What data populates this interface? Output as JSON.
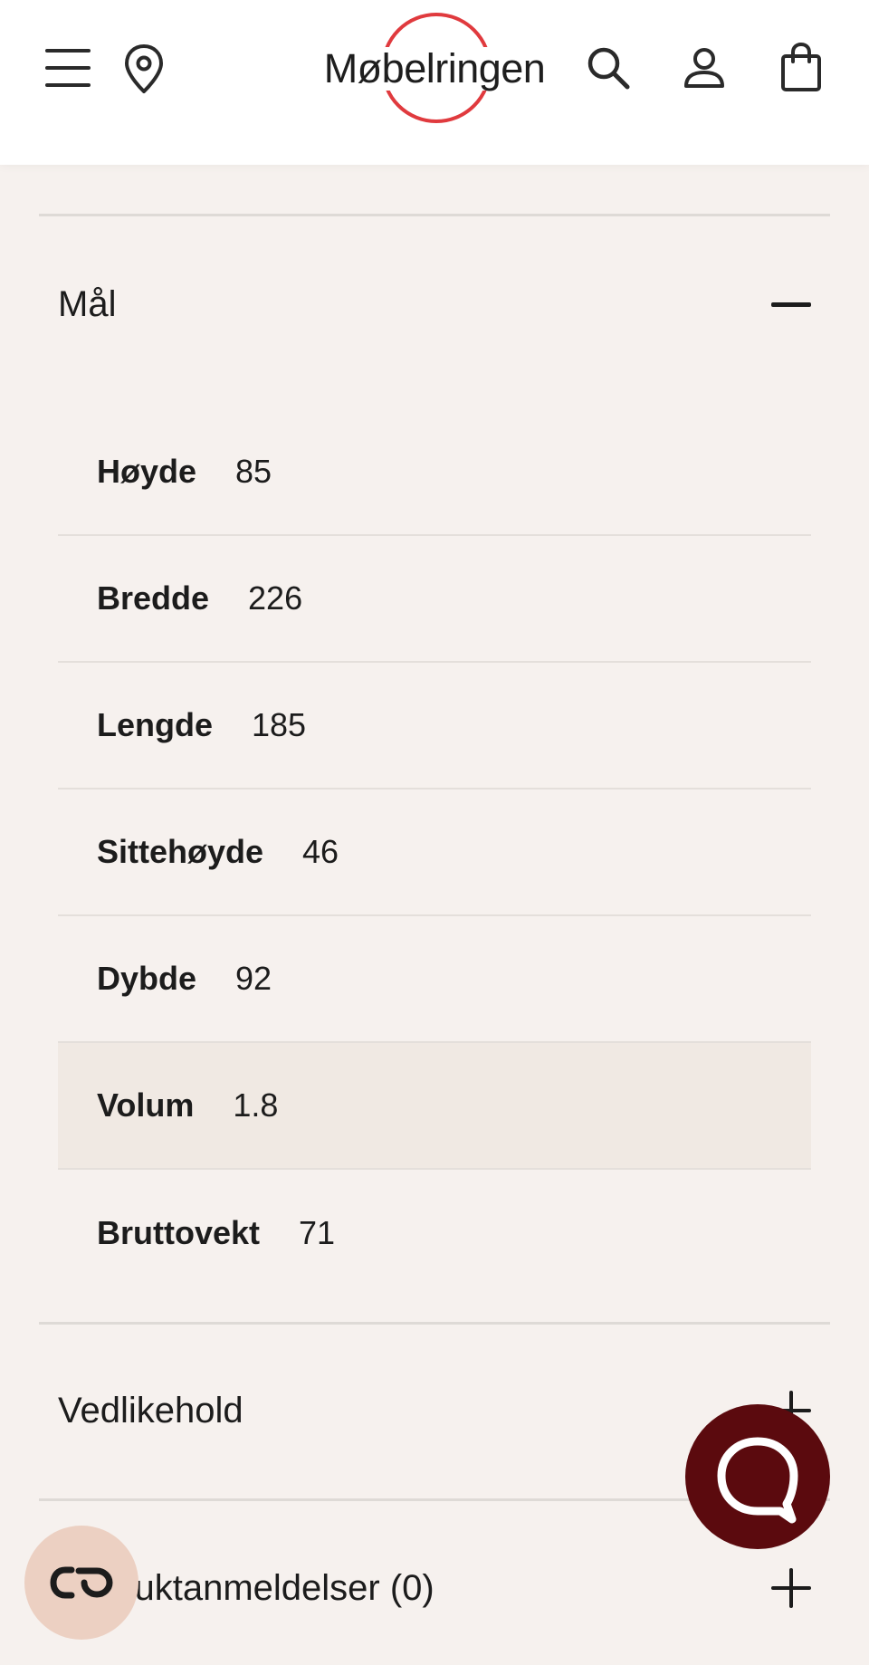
{
  "header": {
    "menu_icon": "hamburger-menu-icon",
    "location_icon": "map-pin-icon",
    "logo_text": "Møbelringen",
    "search_icon": "search-icon",
    "account_icon": "user-icon",
    "cart_icon": "shopping-bag-icon",
    "brand_color": "#e03a3e"
  },
  "sections": {
    "dimensions": {
      "title": "Mål",
      "expanded": true,
      "rows": [
        {
          "label": "Høyde",
          "value": "85"
        },
        {
          "label": "Bredde",
          "value": "226"
        },
        {
          "label": "Lengde",
          "value": "185"
        },
        {
          "label": "Sittehøyde",
          "value": "46"
        },
        {
          "label": "Dybde",
          "value": "92"
        },
        {
          "label": "Volum",
          "value": "1.8"
        },
        {
          "label": "Bruttovekt",
          "value": "71"
        }
      ]
    },
    "maintenance": {
      "title": "Vedlikehold",
      "expanded": false
    },
    "reviews": {
      "title": "Produktanmeldelser (0)",
      "expanded": false
    }
  },
  "floating": {
    "chat_icon": "chat-bubble-icon",
    "chat_color": "#5b0a0e",
    "accessibility_icon": "accessibility-toggle-icon"
  }
}
